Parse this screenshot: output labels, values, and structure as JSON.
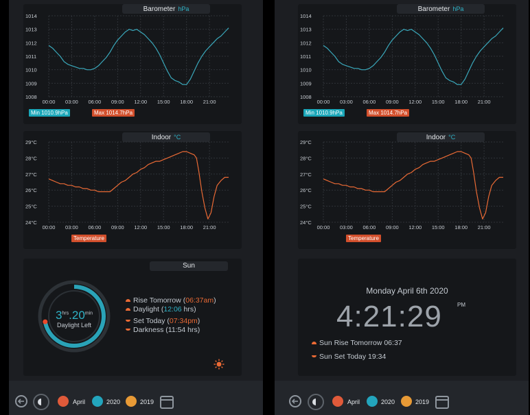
{
  "barometer": {
    "title": "Barometer",
    "unit": "hPa",
    "min_label": "Min 1010.9hPa",
    "max_label": "Max 1014.7hPa",
    "chart_data": {
      "type": "line",
      "title": "Barometer",
      "y_ticks": [
        "1014",
        "1013",
        "1012",
        "1011",
        "1010",
        "1009",
        "1008"
      ],
      "x_ticks": [
        "00:00",
        "03:00",
        "06:00",
        "09:00",
        "12:00",
        "15:00",
        "18:00",
        "21:00"
      ],
      "ylim": [
        1008,
        1014
      ],
      "xlim": [
        0,
        23.5
      ],
      "grid": true,
      "color": "#3aa8bb",
      "series": [
        {
          "x": [
            0,
            0.5,
            1,
            1.5,
            2,
            2.5,
            3,
            3.5,
            4,
            4.5,
            5,
            5.5,
            6,
            6.5,
            7,
            7.5,
            8,
            8.5,
            9,
            9.5,
            10,
            10.5,
            11,
            11.5,
            12,
            12.5,
            13,
            13.5,
            14,
            14.5,
            15,
            15.5,
            16,
            16.5,
            17,
            17.5,
            18,
            18.5,
            19,
            19.5,
            20,
            20.5,
            21,
            21.5,
            22,
            22.5,
            23,
            23.5
          ],
          "values": [
            1011.8,
            1011.6,
            1011.3,
            1011.0,
            1010.6,
            1010.4,
            1010.3,
            1010.2,
            1010.1,
            1010.1,
            1010.0,
            1010.0,
            1010.1,
            1010.3,
            1010.6,
            1010.9,
            1011.3,
            1011.8,
            1012.2,
            1012.5,
            1012.8,
            1013.0,
            1012.9,
            1013.0,
            1012.8,
            1012.6,
            1012.3,
            1012.0,
            1011.6,
            1011.1,
            1010.5,
            1009.9,
            1009.4,
            1009.2,
            1009.1,
            1008.9,
            1008.9,
            1009.3,
            1009.9,
            1010.5,
            1011.0,
            1011.4,
            1011.7,
            1012.0,
            1012.3,
            1012.5,
            1012.8,
            1013.1
          ]
        }
      ]
    }
  },
  "indoor": {
    "title": "Indoor",
    "unit": "°C",
    "legend": "Temperature",
    "chart_data": {
      "type": "line",
      "title": "Indoor",
      "y_ticks": [
        "29°C",
        "28°C",
        "27°C",
        "26°C",
        "25°C",
        "24°C"
      ],
      "x_ticks": [
        "00:00",
        "03:00",
        "06:00",
        "09:00",
        "12:00",
        "15:00",
        "18:00",
        "21:00"
      ],
      "ylim": [
        24,
        29
      ],
      "xlim": [
        0,
        23.5
      ],
      "grid": true,
      "color": "#ea6a35",
      "series": [
        {
          "name": "Temperature",
          "x": [
            0,
            0.5,
            1,
            1.5,
            2,
            2.5,
            3,
            3.5,
            4,
            4.5,
            5,
            5.5,
            6,
            6.5,
            7,
            7.5,
            8,
            8.5,
            9,
            9.5,
            10,
            10.5,
            11,
            11.5,
            12,
            12.5,
            13,
            13.5,
            14,
            14.5,
            15,
            15.5,
            16,
            16.5,
            17,
            17.5,
            18,
            18.5,
            19,
            19.3,
            19.6,
            20,
            20.4,
            20.8,
            21.2,
            21.6,
            22,
            22.5,
            23,
            23.5
          ],
          "values": [
            26.7,
            26.6,
            26.5,
            26.4,
            26.4,
            26.3,
            26.3,
            26.2,
            26.2,
            26.1,
            26.1,
            26.0,
            26.0,
            25.9,
            25.9,
            25.9,
            25.9,
            26.1,
            26.3,
            26.5,
            26.6,
            26.8,
            27.0,
            27.1,
            27.3,
            27.4,
            27.6,
            27.7,
            27.8,
            27.8,
            27.9,
            28.0,
            28.1,
            28.2,
            28.3,
            28.4,
            28.4,
            28.3,
            28.2,
            28.0,
            27.2,
            25.9,
            24.9,
            24.2,
            24.6,
            25.6,
            26.3,
            26.6,
            26.8,
            26.8
          ]
        }
      ]
    }
  },
  "sun": {
    "title": "Sun",
    "daylight_hours": "3",
    "hrs_label": "hrs",
    "daylight_minutes": ".20",
    "min_label": "min",
    "daylight_left_label": "Daylight Left",
    "daylight_fraction": 0.72,
    "rise_label": "Rise Tomorrow (",
    "rise_value": "06:37am",
    "daylight_label": "Daylight (",
    "daylight_value": "12:06",
    "daylight_suffix": " hrs)",
    "set_label": "Set Today (",
    "set_value": "07:34pm",
    "darkness_text": "Darkness (11:54 hrs)",
    "close_paren": ")",
    "icon": "sun-icon"
  },
  "clock": {
    "date": "Monday April 6th 2020",
    "time": "4:21:29",
    "ampm": "PM",
    "rise_text": "Sun Rise Tomorrow 06:37",
    "set_text": "Sun Set Today 19:34"
  },
  "toolbar": {
    "items": [
      {
        "label": "April",
        "color": "#e05a3a"
      },
      {
        "label": "2020",
        "color": "#23a5bd"
      },
      {
        "label": "2019",
        "color": "#e89a36"
      }
    ]
  },
  "colors": {
    "accent_teal": "#2fb3c7",
    "accent_orange": "#ea6a35",
    "min_badge": "#1aa6b8",
    "max_badge": "#d24f2c"
  }
}
